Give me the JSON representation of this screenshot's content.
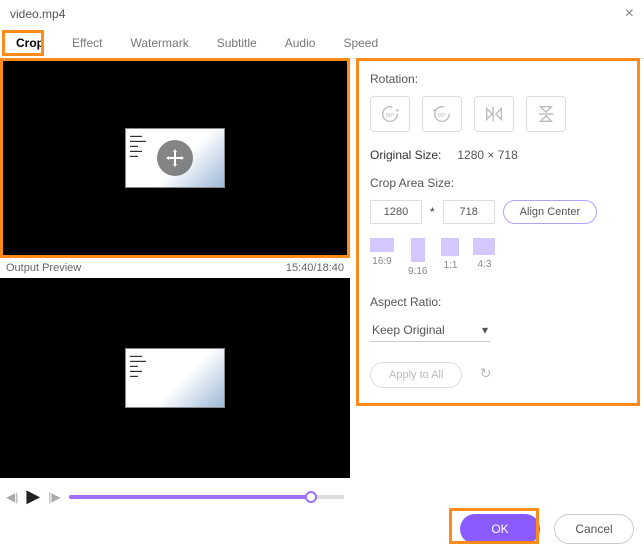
{
  "title": "video.mp4",
  "tabs": [
    "Crop",
    "Effect",
    "Watermark",
    "Subtitle",
    "Audio",
    "Speed"
  ],
  "output_preview_label": "Output Preview",
  "time": "15:40/18:40",
  "panel": {
    "rotation_label": "Rotation:",
    "original_size_label": "Original Size:",
    "original_size_value": "1280 × 718",
    "crop_area_label": "Crop Area Size:",
    "crop_w": "1280",
    "crop_sep": "*",
    "crop_h": "718",
    "align_center": "Align Center",
    "ratios": [
      {
        "label": "16:9"
      },
      {
        "label": "9:16"
      },
      {
        "label": "1:1"
      },
      {
        "label": "4:3"
      }
    ],
    "aspect_ratio_label": "Aspect Ratio:",
    "aspect_ratio_value": "Keep Original",
    "apply_all": "Apply to All"
  },
  "footer": {
    "ok": "OK",
    "cancel": "Cancel"
  }
}
